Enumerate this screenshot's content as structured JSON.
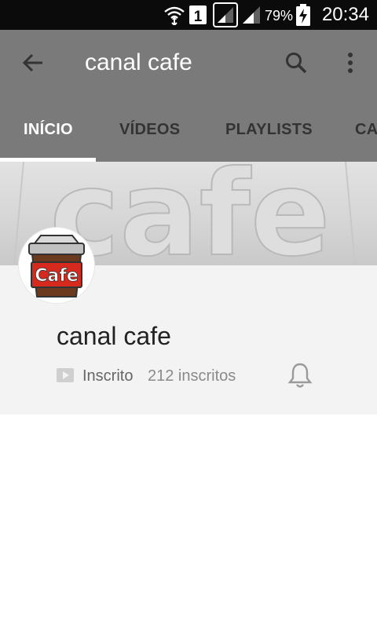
{
  "status_bar": {
    "sim_slot": "1",
    "battery_percent": "79%",
    "time": "20:34",
    "icons": [
      "wifi-icon",
      "sim-1-icon",
      "signal-icon",
      "signal-icon",
      "battery-charging-icon"
    ]
  },
  "app_bar": {
    "title": "canal cafe",
    "icons": [
      "back-arrow-icon",
      "search-icon",
      "more-vert-icon"
    ]
  },
  "tabs": [
    {
      "label": "INÍCIO",
      "active": true
    },
    {
      "label": "VÍDEOS",
      "active": false
    },
    {
      "label": "PLAYLISTS",
      "active": false
    },
    {
      "label": "CA",
      "active": false
    }
  ],
  "banner": {
    "text": "cafe"
  },
  "avatar": {
    "text": "Cafe"
  },
  "channel": {
    "name": "canal cafe",
    "subscribed_label": "Inscrito",
    "subscriber_count": "212 inscritos",
    "icons": [
      "subscribed-icon",
      "bell-icon"
    ]
  },
  "colors": {
    "app_bar": "#7a7a7a",
    "status_bar": "#0b0b0b",
    "info_background": "#f3f3f3",
    "cup_red": "#d62a1f",
    "cup_lid": "#c0c0c0"
  }
}
